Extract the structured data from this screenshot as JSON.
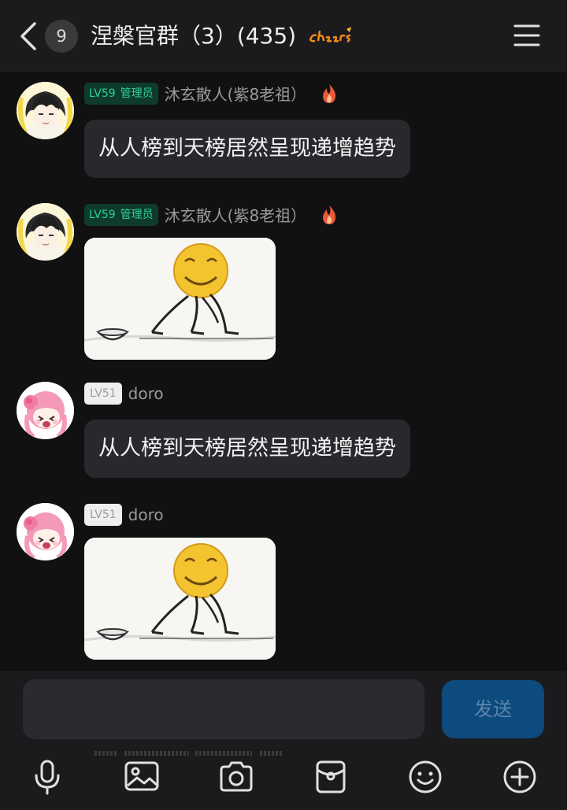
{
  "header": {
    "unread_count": "9",
    "title": "涅槃官群（3）(435)"
  },
  "messages": [
    {
      "level": "LV59",
      "role": "管理员",
      "nickname": "沐玄散人(紫8老祖）",
      "type": "text",
      "text": "从人榜到天榜居然呈现递增趋势"
    },
    {
      "level": "LV59",
      "role": "管理员",
      "nickname": "沐玄散人(紫8老祖）",
      "type": "image"
    },
    {
      "level": "LV51",
      "nickname": "doro",
      "type": "text",
      "text": "从人榜到天榜居然呈现递增趋势"
    },
    {
      "level": "LV51",
      "nickname": "doro",
      "type": "image"
    }
  ],
  "composer": {
    "send_label": "发送"
  },
  "colors": {
    "background": "#111111",
    "bubble": "#27292d",
    "admin_badge_text": "#2ed196",
    "send_button": "#0d4a7e"
  },
  "icons": [
    "back-chevron-icon",
    "cheers-icon",
    "menu-icon",
    "flame-icon",
    "microphone-icon",
    "gallery-icon",
    "camera-icon",
    "red-packet-icon",
    "emoji-icon",
    "plus-icon"
  ]
}
